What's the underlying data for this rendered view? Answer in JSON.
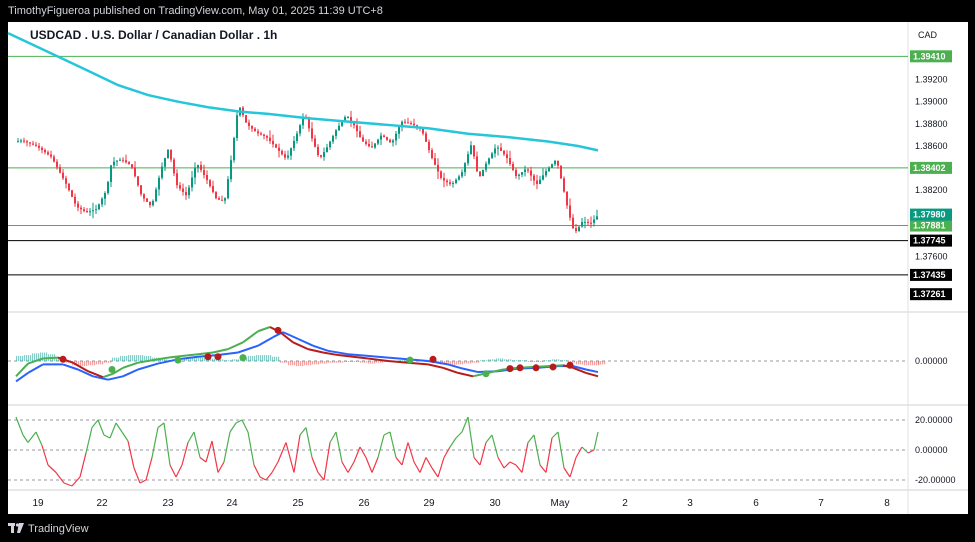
{
  "header": {
    "published": "TimothyFigueroa published on TradingView.com, May 01, 2025 11:39 UTC+8"
  },
  "footer": {
    "brand": "TradingView"
  },
  "chart_data": {
    "type": "candlestick",
    "title": "USDCAD . U.S. Dollar / Canadian Dollar . 1h",
    "currency": "CAD",
    "price_axis": {
      "ticks": [
        "1.39200",
        "1.39000",
        "1.38800",
        "1.38600",
        "1.38200",
        "1.37600"
      ],
      "range": [
        1.371,
        1.3972
      ]
    },
    "x_axis": {
      "ticks": [
        "19",
        "22",
        "23",
        "24",
        "25",
        "26",
        "29",
        "30",
        "May",
        "2",
        "3",
        "6",
        "7",
        "8"
      ]
    },
    "horizontal_levels": [
      {
        "value": 1.3941,
        "label": "1.39410",
        "color": "#4caf50"
      },
      {
        "value": 1.38402,
        "label": "1.38402",
        "color": "#4caf50"
      },
      {
        "value": 1.37881,
        "label": "1.37881",
        "color": "#4caf50"
      },
      {
        "value": 1.37745,
        "label": "1.37745",
        "color": "#ffffff"
      },
      {
        "value": 1.37435,
        "label": "1.37435",
        "color": "#ffffff"
      }
    ],
    "extra_labels": [
      {
        "value": 1.3798,
        "label": "1.37980",
        "color": "#089981"
      },
      {
        "value": 1.37261,
        "label": "1.37261",
        "color": "#ffffff"
      }
    ],
    "moving_average": {
      "color": "#26c6da",
      "points": [
        [
          0,
          1.3962
        ],
        [
          40,
          1.3945
        ],
        [
          80,
          1.3928
        ],
        [
          110,
          1.3915
        ],
        [
          140,
          1.3906
        ],
        [
          170,
          1.39
        ],
        [
          200,
          1.3895
        ],
        [
          232,
          1.3891
        ],
        [
          260,
          1.3889
        ],
        [
          300,
          1.3885
        ],
        [
          340,
          1.3882
        ],
        [
          380,
          1.3879
        ],
        [
          420,
          1.3876
        ],
        [
          460,
          1.3871
        ],
        [
          500,
          1.3868
        ],
        [
          540,
          1.3864
        ],
        [
          570,
          1.386
        ],
        [
          590,
          1.3856
        ]
      ]
    },
    "price_path": [
      [
        0,
        1.3862
      ],
      [
        15,
        1.3865
      ],
      [
        30,
        1.386
      ],
      [
        45,
        1.385
      ],
      [
        60,
        1.3825
      ],
      [
        70,
        1.3805
      ],
      [
        80,
        1.38
      ],
      [
        90,
        1.3803
      ],
      [
        100,
        1.382
      ],
      [
        105,
        1.3845
      ],
      [
        115,
        1.3848
      ],
      [
        125,
        1.3842
      ],
      [
        135,
        1.3815
      ],
      [
        145,
        1.3805
      ],
      [
        155,
        1.384
      ],
      [
        162,
        1.3858
      ],
      [
        170,
        1.3825
      ],
      [
        180,
        1.3815
      ],
      [
        190,
        1.3845
      ],
      [
        200,
        1.383
      ],
      [
        210,
        1.3812
      ],
      [
        218,
        1.381
      ],
      [
        225,
        1.385
      ],
      [
        232,
        1.3898
      ],
      [
        240,
        1.388
      ],
      [
        250,
        1.3872
      ],
      [
        260,
        1.3868
      ],
      [
        270,
        1.3858
      ],
      [
        280,
        1.3848
      ],
      [
        290,
        1.387
      ],
      [
        298,
        1.389
      ],
      [
        305,
        1.3868
      ],
      [
        313,
        1.3848
      ],
      [
        320,
        1.3858
      ],
      [
        330,
        1.3875
      ],
      [
        340,
        1.3888
      ],
      [
        348,
        1.3878
      ],
      [
        355,
        1.3865
      ],
      [
        365,
        1.3858
      ],
      [
        375,
        1.387
      ],
      [
        385,
        1.3862
      ],
      [
        395,
        1.3882
      ],
      [
        405,
        1.388
      ],
      [
        415,
        1.3875
      ],
      [
        425,
        1.385
      ],
      [
        435,
        1.383
      ],
      [
        445,
        1.3825
      ],
      [
        455,
        1.3835
      ],
      [
        465,
        1.3862
      ],
      [
        472,
        1.383
      ],
      [
        480,
        1.3845
      ],
      [
        490,
        1.386
      ],
      [
        500,
        1.385
      ],
      [
        510,
        1.3832
      ],
      [
        520,
        1.384
      ],
      [
        530,
        1.3825
      ],
      [
        540,
        1.3838
      ],
      [
        550,
        1.3848
      ],
      [
        556,
        1.3825
      ],
      [
        562,
        1.38
      ],
      [
        568,
        1.3781
      ],
      [
        576,
        1.3792
      ],
      [
        584,
        1.379
      ],
      [
        592,
        1.3798
      ]
    ],
    "macd": {
      "zero_label": "0.00000",
      "macd_line": [
        [
          8,
          -18
        ],
        [
          20,
          -3
        ],
        [
          35,
          3
        ],
        [
          50,
          4
        ],
        [
          65,
          -2
        ],
        [
          80,
          -12
        ],
        [
          95,
          -19
        ],
        [
          105,
          -15
        ],
        [
          115,
          -8
        ],
        [
          130,
          -2
        ],
        [
          145,
          1
        ],
        [
          160,
          4
        ],
        [
          175,
          6
        ],
        [
          190,
          8
        ],
        [
          205,
          10
        ],
        [
          220,
          14
        ],
        [
          235,
          22
        ],
        [
          250,
          35
        ],
        [
          262,
          40
        ],
        [
          272,
          34
        ],
        [
          285,
          22
        ],
        [
          300,
          14
        ],
        [
          315,
          10
        ],
        [
          330,
          7
        ],
        [
          345,
          5
        ],
        [
          360,
          3
        ],
        [
          380,
          0
        ],
        [
          400,
          -2
        ],
        [
          420,
          -4
        ],
        [
          435,
          -8
        ],
        [
          450,
          -14
        ],
        [
          465,
          -18
        ],
        [
          480,
          -14
        ],
        [
          495,
          -10
        ],
        [
          510,
          -8
        ],
        [
          525,
          -7
        ],
        [
          540,
          -6
        ],
        [
          555,
          -5
        ],
        [
          565,
          -8
        ],
        [
          578,
          -14
        ],
        [
          590,
          -18
        ]
      ],
      "signal_line": [
        [
          8,
          -24
        ],
        [
          20,
          -14
        ],
        [
          35,
          -4
        ],
        [
          55,
          -4
        ],
        [
          70,
          -10
        ],
        [
          85,
          -18
        ],
        [
          100,
          -22
        ],
        [
          115,
          -18
        ],
        [
          130,
          -10
        ],
        [
          150,
          -3
        ],
        [
          170,
          2
        ],
        [
          190,
          5
        ],
        [
          210,
          7
        ],
        [
          230,
          10
        ],
        [
          250,
          18
        ],
        [
          265,
          28
        ],
        [
          275,
          34
        ],
        [
          290,
          26
        ],
        [
          305,
          18
        ],
        [
          320,
          12
        ],
        [
          340,
          8
        ],
        [
          360,
          6
        ],
        [
          380,
          4
        ],
        [
          400,
          2
        ],
        [
          420,
          0
        ],
        [
          440,
          -4
        ],
        [
          455,
          -9
        ],
        [
          470,
          -13
        ],
        [
          490,
          -12
        ],
        [
          510,
          -9
        ],
        [
          530,
          -8
        ],
        [
          550,
          -6
        ],
        [
          565,
          -6
        ],
        [
          578,
          -10
        ],
        [
          590,
          -13
        ]
      ],
      "histogram": [
        [
          8,
          6
        ],
        [
          16,
          7
        ],
        [
          24,
          9
        ],
        [
          32,
          10
        ],
        [
          40,
          8
        ],
        [
          48,
          5
        ],
        [
          56,
          -2
        ],
        [
          64,
          -5
        ],
        [
          72,
          -6
        ],
        [
          80,
          -5
        ],
        [
          88,
          -4
        ],
        [
          96,
          -2
        ],
        [
          104,
          4
        ],
        [
          112,
          6
        ],
        [
          120,
          7
        ],
        [
          128,
          7
        ],
        [
          136,
          6
        ],
        [
          144,
          4
        ],
        [
          152,
          2
        ],
        [
          160,
          1
        ],
        [
          168,
          -1
        ],
        [
          176,
          3
        ],
        [
          184,
          5
        ],
        [
          192,
          4
        ],
        [
          200,
          3
        ],
        [
          208,
          2
        ],
        [
          216,
          1
        ],
        [
          224,
          2
        ],
        [
          232,
          4
        ],
        [
          240,
          6
        ],
        [
          248,
          7
        ],
        [
          256,
          7
        ],
        [
          264,
          5
        ],
        [
          272,
          -2
        ],
        [
          280,
          -5
        ],
        [
          288,
          -6
        ],
        [
          296,
          -5
        ],
        [
          304,
          -4
        ],
        [
          312,
          -3
        ],
        [
          320,
          -2
        ],
        [
          328,
          -2
        ],
        [
          336,
          -1
        ],
        [
          344,
          -1
        ],
        [
          352,
          -2
        ],
        [
          360,
          -3
        ],
        [
          368,
          -2
        ],
        [
          376,
          -1
        ],
        [
          384,
          -1
        ],
        [
          392,
          1
        ],
        [
          400,
          2
        ],
        [
          408,
          1
        ],
        [
          416,
          -1
        ],
        [
          424,
          -2
        ],
        [
          432,
          -4
        ],
        [
          440,
          -5
        ],
        [
          448,
          -4
        ],
        [
          456,
          -3
        ],
        [
          464,
          -2
        ],
        [
          472,
          1
        ],
        [
          480,
          2
        ],
        [
          488,
          3
        ],
        [
          496,
          2
        ],
        [
          504,
          1
        ],
        [
          512,
          1
        ],
        [
          520,
          -1
        ],
        [
          528,
          -1
        ],
        [
          536,
          1
        ],
        [
          544,
          2
        ],
        [
          552,
          1
        ],
        [
          560,
          -2
        ],
        [
          568,
          -4
        ],
        [
          576,
          -5
        ],
        [
          584,
          -5
        ],
        [
          590,
          -4
        ]
      ],
      "cross_up": [
        [
          104,
          -10
        ],
        [
          170,
          1
        ],
        [
          235,
          4
        ],
        [
          402,
          1
        ],
        [
          478,
          -15
        ]
      ],
      "cross_down": [
        [
          55,
          2
        ],
        [
          200,
          5
        ],
        [
          210,
          5
        ],
        [
          270,
          36
        ],
        [
          425,
          2
        ],
        [
          502,
          -9
        ],
        [
          512,
          -8
        ],
        [
          528,
          -8
        ],
        [
          545,
          -7
        ],
        [
          562,
          -5
        ]
      ]
    },
    "oscillator": {
      "labels": [
        "20.00000",
        "0.00000",
        "-20.00000"
      ],
      "levels": [
        20,
        0,
        -20
      ],
      "line": [
        [
          8,
          22
        ],
        [
          15,
          10
        ],
        [
          20,
          5
        ],
        [
          28,
          12
        ],
        [
          34,
          3
        ],
        [
          40,
          -10
        ],
        [
          48,
          -15
        ],
        [
          56,
          -22
        ],
        [
          64,
          -24
        ],
        [
          72,
          -18
        ],
        [
          78,
          -2
        ],
        [
          84,
          15
        ],
        [
          90,
          20
        ],
        [
          96,
          10
        ],
        [
          102,
          8
        ],
        [
          108,
          18
        ],
        [
          114,
          12
        ],
        [
          120,
          6
        ],
        [
          126,
          -12
        ],
        [
          132,
          -22
        ],
        [
          138,
          -20
        ],
        [
          144,
          -5
        ],
        [
          150,
          15
        ],
        [
          156,
          18
        ],
        [
          162,
          -10
        ],
        [
          168,
          -18
        ],
        [
          174,
          -10
        ],
        [
          180,
          5
        ],
        [
          186,
          12
        ],
        [
          192,
          -5
        ],
        [
          198,
          -8
        ],
        [
          204,
          6
        ],
        [
          210,
          -15
        ],
        [
          216,
          -8
        ],
        [
          222,
          12
        ],
        [
          228,
          18
        ],
        [
          234,
          20
        ],
        [
          240,
          12
        ],
        [
          246,
          -10
        ],
        [
          252,
          -18
        ],
        [
          258,
          -20
        ],
        [
          264,
          -15
        ],
        [
          270,
          -8
        ],
        [
          278,
          5
        ],
        [
          286,
          -15
        ],
        [
          292,
          10
        ],
        [
          298,
          15
        ],
        [
          304,
          -5
        ],
        [
          310,
          -15
        ],
        [
          316,
          -20
        ],
        [
          322,
          5
        ],
        [
          328,
          12
        ],
        [
          334,
          -8
        ],
        [
          340,
          -15
        ],
        [
          346,
          -8
        ],
        [
          352,
          2
        ],
        [
          358,
          -5
        ],
        [
          364,
          -15
        ],
        [
          370,
          -5
        ],
        [
          376,
          10
        ],
        [
          382,
          12
        ],
        [
          388,
          -5
        ],
        [
          394,
          -10
        ],
        [
          400,
          5
        ],
        [
          406,
          -8
        ],
        [
          412,
          -15
        ],
        [
          418,
          -5
        ],
        [
          424,
          -12
        ],
        [
          430,
          -18
        ],
        [
          436,
          -5
        ],
        [
          442,
          2
        ],
        [
          448,
          8
        ],
        [
          454,
          12
        ],
        [
          460,
          22
        ],
        [
          466,
          -5
        ],
        [
          472,
          -10
        ],
        [
          478,
          5
        ],
        [
          484,
          10
        ],
        [
          490,
          -5
        ],
        [
          496,
          -12
        ],
        [
          502,
          -8
        ],
        [
          508,
          -10
        ],
        [
          514,
          -15
        ],
        [
          520,
          5
        ],
        [
          526,
          10
        ],
        [
          532,
          -10
        ],
        [
          538,
          -15
        ],
        [
          544,
          8
        ],
        [
          550,
          12
        ],
        [
          556,
          -12
        ],
        [
          562,
          -18
        ],
        [
          568,
          -5
        ],
        [
          574,
          2
        ],
        [
          580,
          -2
        ],
        [
          586,
          0
        ],
        [
          590,
          12
        ]
      ]
    }
  }
}
